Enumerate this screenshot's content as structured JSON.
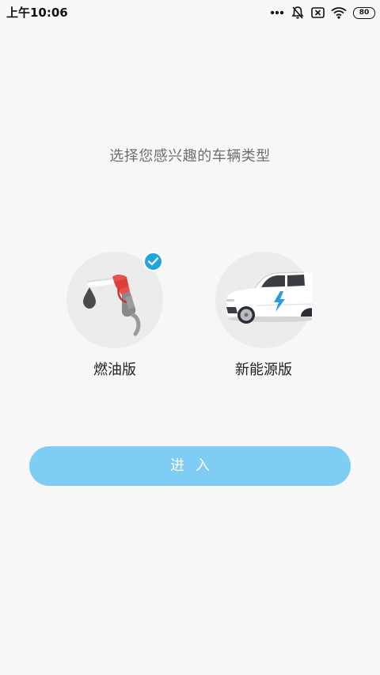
{
  "status_bar": {
    "time": "上午10:06",
    "battery": "80",
    "icons": [
      "more-dots-icon",
      "notifications-off-icon",
      "sim-error-icon",
      "wifi-icon",
      "battery-icon"
    ]
  },
  "prompt": "选择您感兴趣的车辆类型",
  "options": [
    {
      "label": "燃油版",
      "icon": "fuel-pump-icon",
      "selected": true
    },
    {
      "label": "新能源版",
      "icon": "electric-car-icon",
      "selected": false
    }
  ],
  "enter_button": "进入",
  "colors": {
    "background": "#f7f7f7",
    "accent": "#23a4dd",
    "button": "#7fcdf2",
    "fuel_red": "#e8504a",
    "bolt_blue": "#2a9ad8"
  }
}
